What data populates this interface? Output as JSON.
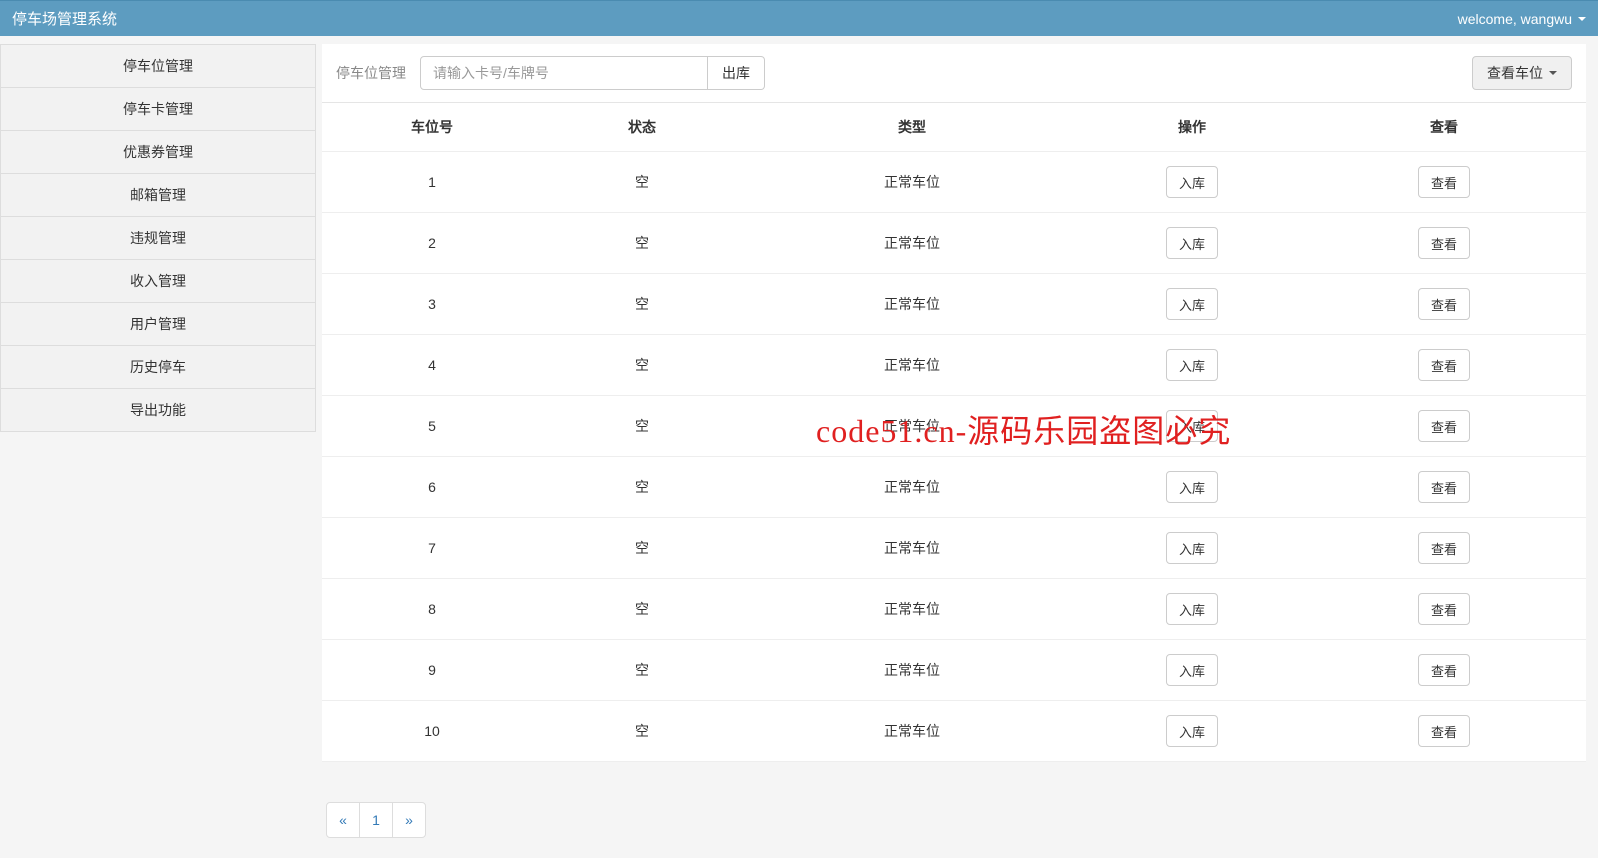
{
  "app": {
    "title": "停车场管理系统"
  },
  "user": {
    "welcome": "welcome, wangwu"
  },
  "sidebar": {
    "items": [
      {
        "label": "停车位管理"
      },
      {
        "label": "停车卡管理"
      },
      {
        "label": "优惠券管理"
      },
      {
        "label": "邮箱管理"
      },
      {
        "label": "违规管理"
      },
      {
        "label": "收入管理"
      },
      {
        "label": "用户管理"
      },
      {
        "label": "历史停车"
      },
      {
        "label": "导出功能"
      }
    ]
  },
  "toolbar": {
    "title": "停车位管理",
    "search_placeholder": "请输入卡号/车牌号",
    "exit_btn": "出库",
    "view_dropdown": "查看车位"
  },
  "table": {
    "headers": {
      "id": "车位号",
      "status": "状态",
      "type": "类型",
      "op": "操作",
      "view": "查看"
    },
    "op_btn": "入库",
    "view_btn": "查看",
    "rows": [
      {
        "id": "1",
        "status": "空",
        "type": "正常车位"
      },
      {
        "id": "2",
        "status": "空",
        "type": "正常车位"
      },
      {
        "id": "3",
        "status": "空",
        "type": "正常车位"
      },
      {
        "id": "4",
        "status": "空",
        "type": "正常车位"
      },
      {
        "id": "5",
        "status": "空",
        "type": "正常车位"
      },
      {
        "id": "6",
        "status": "空",
        "type": "正常车位"
      },
      {
        "id": "7",
        "status": "空",
        "type": "正常车位"
      },
      {
        "id": "8",
        "status": "空",
        "type": "正常车位"
      },
      {
        "id": "9",
        "status": "空",
        "type": "正常车位"
      },
      {
        "id": "10",
        "status": "空",
        "type": "正常车位"
      }
    ]
  },
  "pagination": {
    "prev": "«",
    "page": "1",
    "next": "»"
  },
  "watermark": "code51.cn-源码乐园盗图必究"
}
